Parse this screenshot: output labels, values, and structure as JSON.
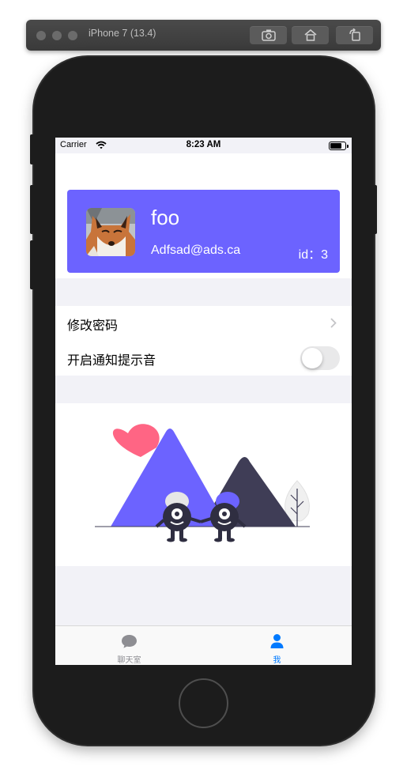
{
  "simulator": {
    "title": "iPhone 7 (13.4)",
    "buttons": [
      "screenshot-icon",
      "home-icon",
      "rotate-icon"
    ]
  },
  "status_bar": {
    "carrier": "Carrier",
    "time": "8:23 AM",
    "battery_level": 0.9
  },
  "profile": {
    "username": "foo",
    "email": "Adfsad@ads.ca",
    "id_label": "id：3",
    "card_color": "#6c63ff"
  },
  "settings": {
    "change_password": "修改密码",
    "notification_sound": "开启通知提示音",
    "notification_sound_enabled": false
  },
  "tabs": [
    {
      "label": "聊天室",
      "icon": "chat-bubble-icon",
      "active": false
    },
    {
      "label": "我",
      "icon": "person-icon",
      "active": true
    }
  ],
  "colors": {
    "accent": "#007aff",
    "tab_inactive": "#8e8e93",
    "illustration_primary": "#6c63ff",
    "illustration_dark": "#3f3d56",
    "heart": "#ff6584"
  }
}
